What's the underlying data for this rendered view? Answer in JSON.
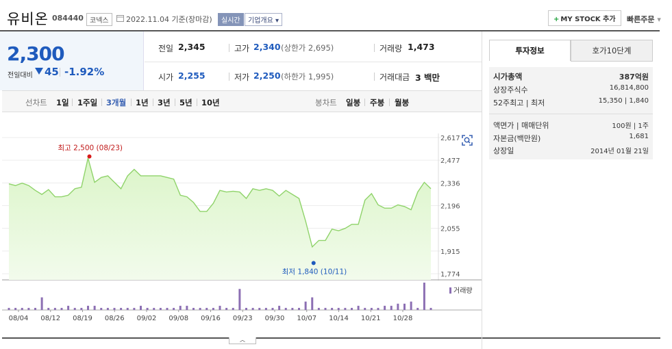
{
  "header": {
    "stock_name": "유비온",
    "stock_code": "084440",
    "market": "코넥스",
    "date": "2022.11.04 기준(장마감)",
    "realtime": "실시간",
    "company_info": "기업개요",
    "mystock_button": "MY STOCK 추가",
    "quick_order": "빠른주문"
  },
  "price": {
    "current": "2,300",
    "change_label": "전일대비",
    "change_abs": "45",
    "change_pct": "-1.92%",
    "direction": "down",
    "color_down": "#1f5bbd"
  },
  "stats": {
    "prev_close_label": "전일",
    "prev_close": "2,345",
    "high_label": "고가",
    "high": "2,340",
    "upper_limit": "(상한가 2,695)",
    "volume_label": "거래량",
    "volume": "1,473",
    "open_label": "시가",
    "open": "2,255",
    "low_label": "저가",
    "low": "2,250",
    "lower_limit": "(하한가 1,995)",
    "amount_label": "거래대금",
    "amount": "3 백만"
  },
  "period_nav": {
    "line_label": "선차트",
    "line_items": [
      "1일",
      "1주일",
      "3개월",
      "1년",
      "3년",
      "5년",
      "10년"
    ],
    "active": "3개월",
    "candle_label": "봉차트",
    "candle_items": [
      "일봉",
      "주봉",
      "월봉"
    ]
  },
  "chart_data": {
    "type": "area",
    "title": "",
    "x_ticks": [
      "08/04",
      "08/12",
      "08/19",
      "08/26",
      "09/02",
      "09/08",
      "09/16",
      "09/23",
      "09/30",
      "10/07",
      "10/14",
      "10/21",
      "10/28"
    ],
    "y_ticks": [
      "2,617",
      "2,477",
      "2,336",
      "2,196",
      "2,055",
      "1,915",
      "1,774"
    ],
    "ylim": [
      1774,
      2617
    ],
    "prices": [
      2330,
      2320,
      2335,
      2320,
      2290,
      2265,
      2295,
      2250,
      2250,
      2260,
      2300,
      2310,
      2490,
      2340,
      2370,
      2380,
      2340,
      2300,
      2380,
      2420,
      2380,
      2380,
      2380,
      2380,
      2370,
      2360,
      2260,
      2250,
      2215,
      2160,
      2160,
      2210,
      2290,
      2280,
      2285,
      2280,
      2240,
      2300,
      2290,
      2300,
      2290,
      2255,
      2290,
      2265,
      2240,
      2100,
      1940,
      1980,
      1980,
      2050,
      2040,
      2055,
      2080,
      2080,
      2230,
      2270,
      2200,
      2180,
      2180,
      2200,
      2190,
      2170,
      2280,
      2340,
      2300
    ],
    "volume": [
      1,
      1,
      1,
      1,
      1,
      6,
      1,
      1,
      1,
      2,
      1,
      1,
      2,
      2,
      1,
      1,
      1,
      1,
      1,
      1,
      2,
      1,
      1,
      1,
      1,
      1,
      2,
      2,
      1,
      1,
      1,
      1,
      2,
      1,
      1,
      10,
      1,
      1,
      1,
      1,
      1,
      2,
      1,
      1,
      1,
      4,
      6,
      1,
      1,
      1,
      1,
      1,
      1,
      2,
      1,
      1,
      1,
      2,
      2,
      3,
      3,
      4,
      1,
      13,
      1
    ],
    "max_label": "최고 2,500 (08/23)",
    "min_label": "최저 1,840 (10/11)",
    "max_value": 2500,
    "min_value": 1840,
    "volume_legend": "거래량",
    "line_color": "#8fd36a",
    "fill_color": "#dbf5c8",
    "volume_color": "#8c6fb3"
  },
  "tabs": {
    "invest": "투자정보",
    "quote": "호가10단계"
  },
  "invest_info": {
    "market_cap_label": "시가총액",
    "market_cap": "387억원",
    "shares_label": "상장주식수",
    "shares": "16,814,800",
    "range52_label": "52주최고 | 최저",
    "range52": "15,350 | 1,840",
    "par_label": "액면가 | 매매단위",
    "par": "100원 | 1주",
    "capital_label": "자본금(백만원)",
    "capital": "1,681",
    "listed_label": "상장일",
    "listed": "2014년 01월 21일"
  }
}
